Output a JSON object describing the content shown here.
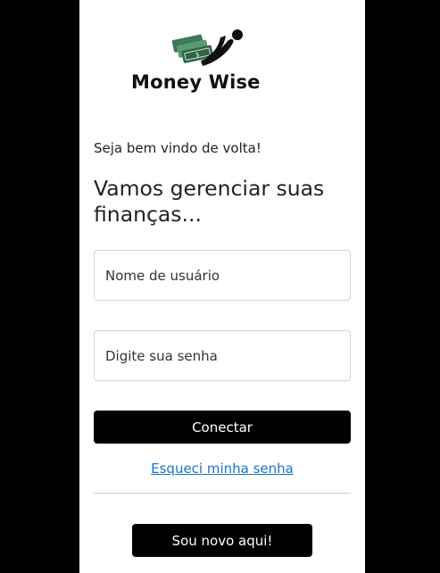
{
  "logo": {
    "text": "Money Wise",
    "icon": "money-flying-person-icon",
    "colors": {
      "green": "#3d7a57",
      "dark": "#111111"
    }
  },
  "welcome_text": "Seja bem vindo de volta!",
  "heading": "Vamos gerenciar suas finanças...",
  "form": {
    "username_placeholder": "Nome de usuário",
    "username_value": "",
    "password_placeholder": "Digite sua senha",
    "password_value": "",
    "connect_label": "Conectar",
    "forgot_label": "Esqueci minha senha"
  },
  "signup": {
    "new_label": "Sou novo aqui!"
  },
  "colors": {
    "background": "#000000",
    "panel": "#ffffff",
    "button": "#000000",
    "button_text": "#ffffff",
    "link": "#1a73c8"
  }
}
